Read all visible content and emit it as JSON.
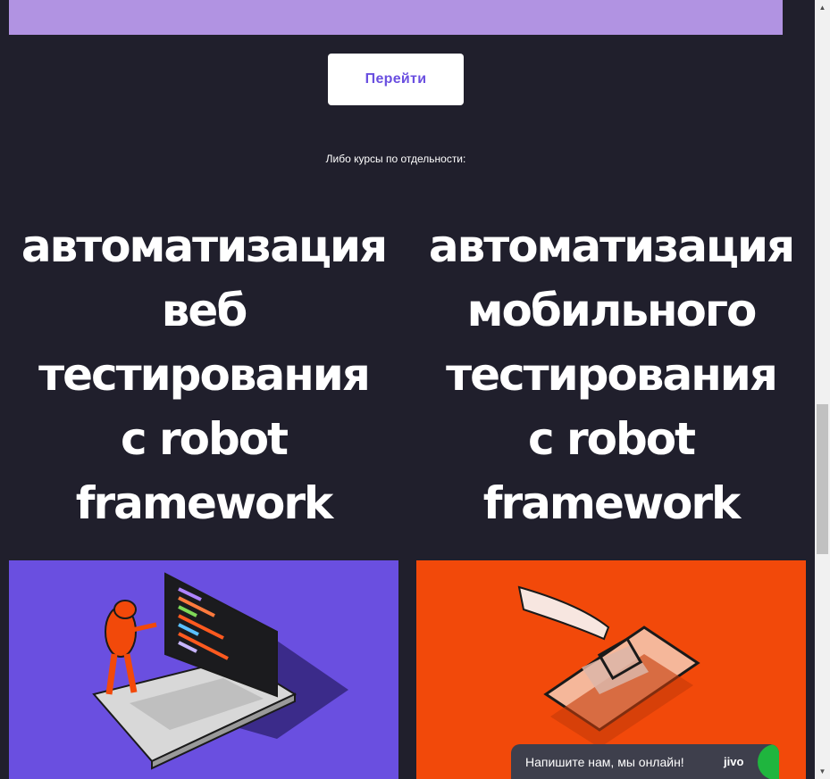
{
  "cta": {
    "go_label": "Перейти"
  },
  "subtitle": "Либо курсы по отдельности:",
  "courses": [
    {
      "title_lines": [
        "автоматизация",
        "веб",
        "тестирования",
        "с robot",
        "framework"
      ]
    },
    {
      "title_lines": [
        "автоматизация",
        "мобильного",
        "тестирования",
        "с robot",
        "framework"
      ]
    }
  ],
  "chat": {
    "message": "Напишите нам, мы онлайн!",
    "brand": "jivo"
  },
  "colors": {
    "background": "#201f2c",
    "banner": "#b193e2",
    "accent_purple": "#6a4fe0",
    "accent_orange": "#f2490a",
    "chat_green": "#1fb53e"
  },
  "icons": [
    "scroll-up-arrow-icon",
    "scroll-down-arrow-icon",
    "laptop-illustration",
    "phone-touch-illustration",
    "jivo-logo-icon"
  ]
}
